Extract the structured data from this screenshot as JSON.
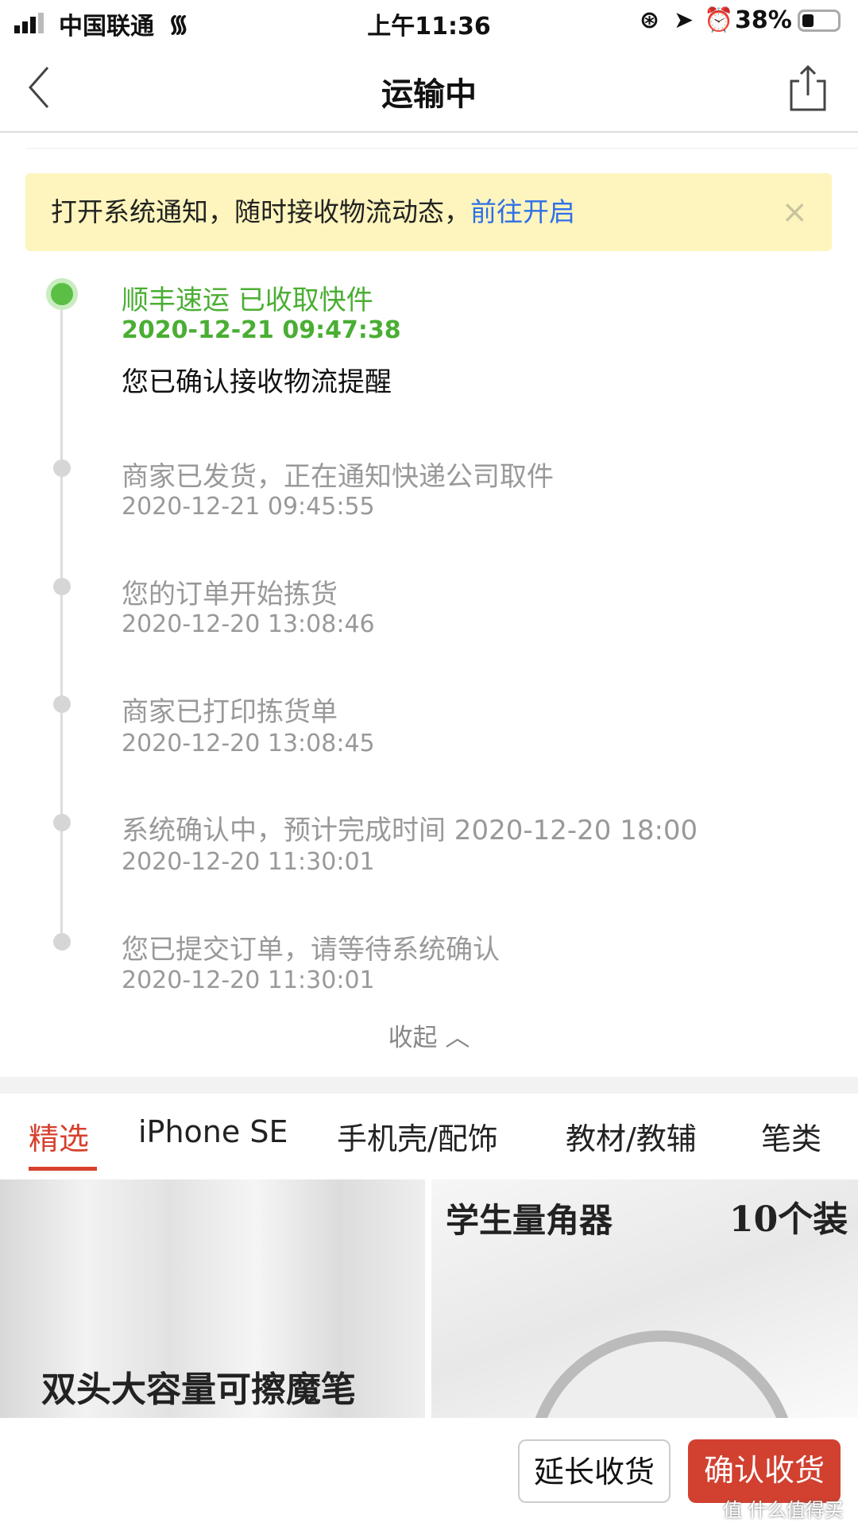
{
  "status_bar": {
    "carrier": "中国联通",
    "time": "上午11:36",
    "battery": "38%",
    "battery_level": 0.38
  },
  "nav": {
    "title": "运输中",
    "back_icon": "chevron-left-icon",
    "share_icon": "share-icon"
  },
  "banner": {
    "text": "打开系统通知，随时接收物流动态，",
    "link": "前往开启",
    "close": "×"
  },
  "timeline": [
    {
      "title": "顺丰速运 已收取快件",
      "date": "2020-12-21 09:47:38",
      "desc": "您已确认接收物流提醒",
      "active": true
    },
    {
      "title": "商家已发货，正在通知快递公司取件",
      "date": "2020-12-21 09:45:55"
    },
    {
      "title": "您的订单开始拣货",
      "date": "2020-12-20 13:08:46"
    },
    {
      "title": "商家已打印拣货单",
      "date": "2020-12-20 13:08:45"
    },
    {
      "title": "系统确认中，预计完成时间 2020-12-20 18:00",
      "date": "2020-12-20 11:30:01"
    },
    {
      "title": "您已提交订单，请等待系统确认",
      "date": "2020-12-20 11:30:01"
    }
  ],
  "collapse": "收起",
  "tabs": [
    "精选",
    "iPhone SE",
    "手机壳/配饰",
    "教材/教辅",
    "笔类"
  ],
  "products": [
    {
      "caption": "双头大容量可擦魔笔"
    },
    {
      "caption": "学生量角器",
      "caption2": "10个装"
    }
  ],
  "buttons": {
    "extend": "延长收货",
    "confirm": "确认收货"
  },
  "watermark": "值 什么值得买",
  "colors": {
    "accent": "#d7402e",
    "active": "#4aae33",
    "link": "#2f6fe8",
    "banner": "#fdf5bd"
  }
}
